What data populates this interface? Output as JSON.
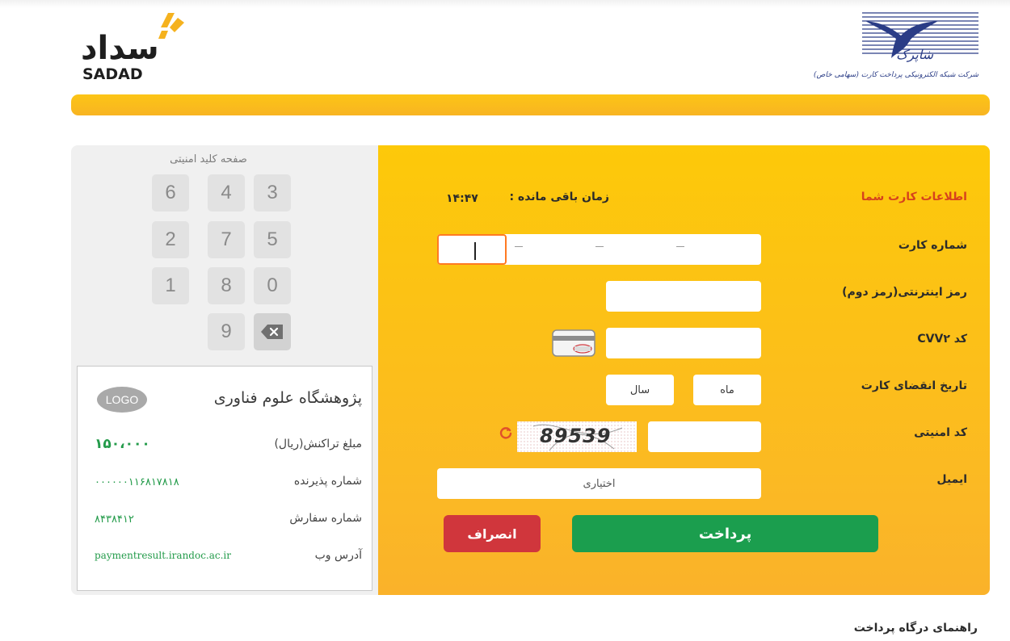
{
  "header": {
    "sadad_logo_persian": "سداد",
    "sadad_logo_latin": "SADAD",
    "shaparak_name": "شاپرک",
    "shaparak_subtitle": "شرکت شبکه الکترونیکی پرداخت کارت (سهامی خاص)",
    "accent_color": "#fbb825"
  },
  "keypad": {
    "title": "صفحه کلید امنیتی",
    "keys": [
      "3",
      "4",
      "6",
      "5",
      "7",
      "2",
      "0",
      "8",
      "1",
      "9"
    ],
    "backspace_icon": "backspace-icon"
  },
  "merchant": {
    "logo_text": "LOGO",
    "name": "پژوهشگاه علوم فناوری",
    "amount_label": "مبلغ تراکنش(ریال)",
    "amount_value": "۱۵۰،۰۰۰",
    "acceptor_label": "شماره پذیرنده",
    "acceptor_value": "۰۰۰۰۰۰۱۱۶۸۱۷۸۱۸",
    "order_label": "شماره سفارش",
    "order_value": "۸۴۳۸۴۱۲",
    "web_label": "آدرس وب",
    "web_value": "paymentresult.irandoc.ac.ir"
  },
  "form": {
    "card_info_title": "اطلاعات کارت شما",
    "timer_label": "زمان باقی مانده :",
    "timer_value": "۱۴:۴۷",
    "card_number_label": "شماره کارت",
    "card_number_separators": [
      "-",
      "-",
      "-"
    ],
    "password_label": "رمز اینترنتی(رمز دوم)",
    "cvv2_label": "کد CVV۲",
    "expiry_label": "تاریخ انقضای کارت",
    "month_placeholder": "ماه",
    "year_placeholder": "سال",
    "captcha_label": "کد امنیتی",
    "captcha_text": "89539",
    "email_label": "ایمیل",
    "email_placeholder": "اختیاری",
    "pay_button": "پرداخت",
    "cancel_button": "انصراف",
    "pay_color": "#1b9e4e",
    "cancel_color": "#d0363c"
  },
  "footer": {
    "guide_title": "راهنمای درگاه پرداخت"
  }
}
